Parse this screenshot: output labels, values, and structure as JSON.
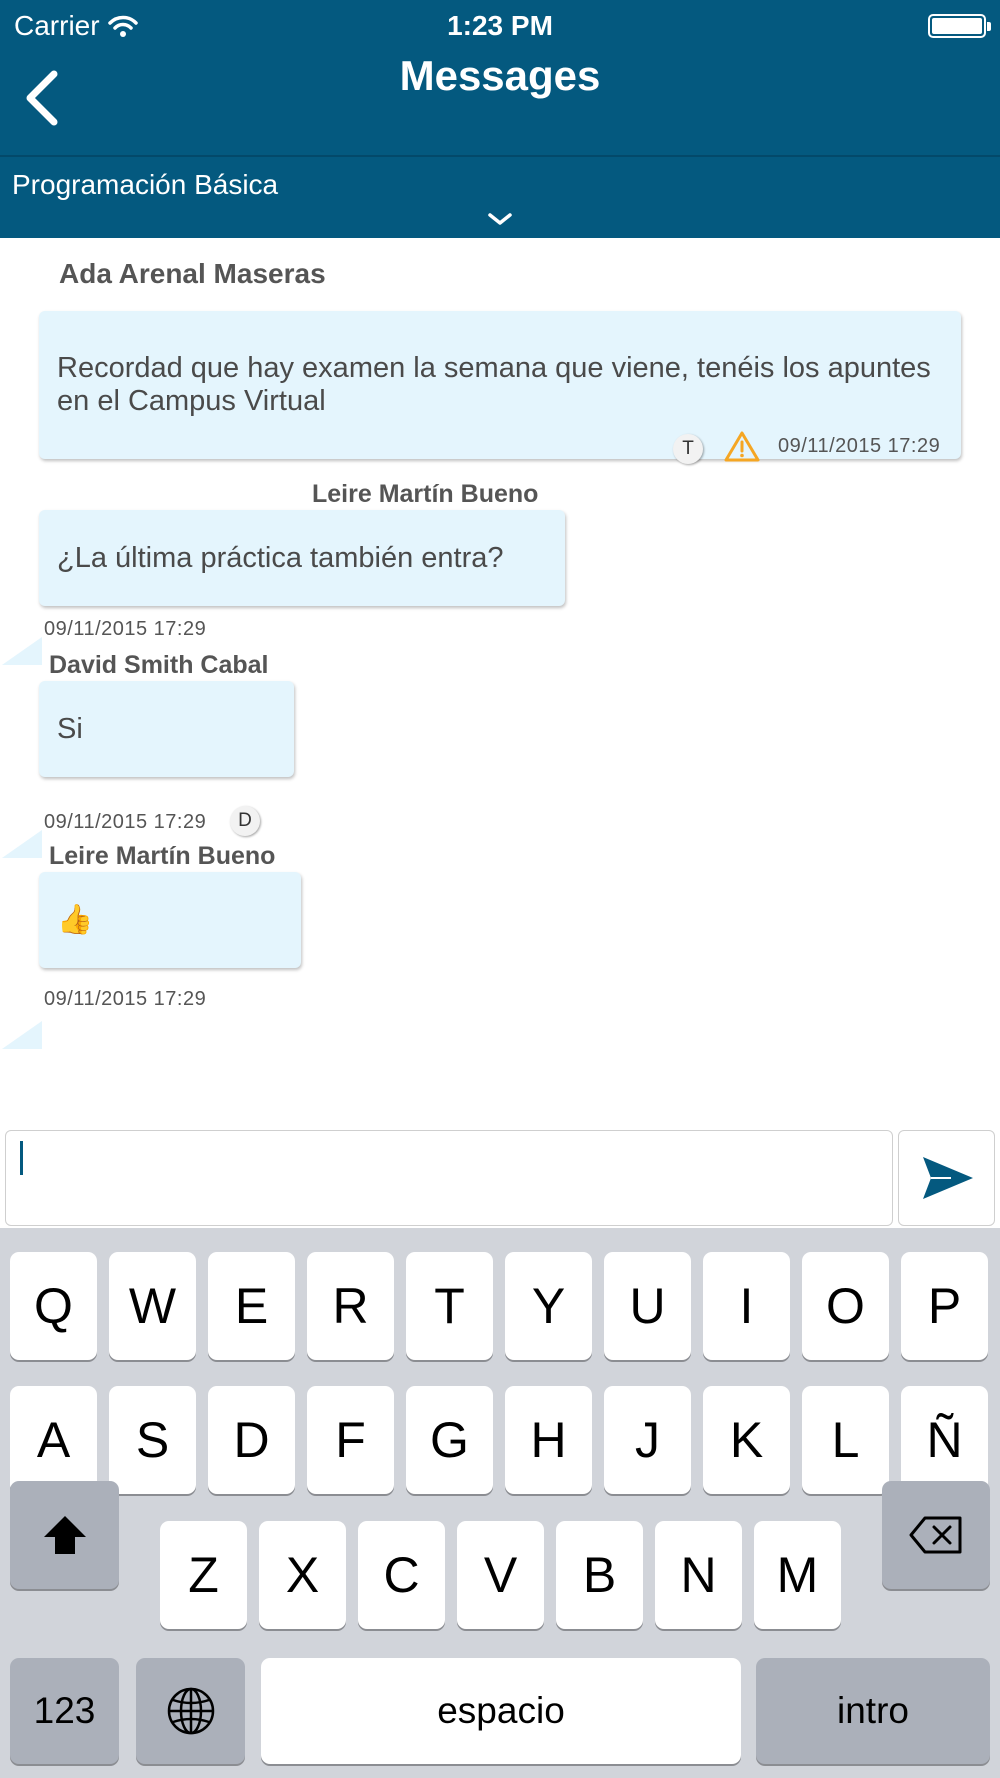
{
  "status_bar": {
    "carrier": "Carrier",
    "time": "1:23 PM"
  },
  "header": {
    "title": "Messages"
  },
  "course": {
    "name": "Programación Básica"
  },
  "messages": [
    {
      "sender": "Ada Arenal Maseras",
      "text": "Recordad que hay examen la semana que viene, tenéis los apuntes en el Campus Virtual",
      "timestamp": "09/11/2015 17:29",
      "avatar_initial": "T",
      "has_warning": true
    },
    {
      "sender": "Leire Martín Bueno",
      "text": "¿La última práctica también entra?",
      "timestamp": "09/11/2015 17:29"
    },
    {
      "sender": "David Smith Cabal",
      "text": "Si",
      "timestamp": "09/11/2015 17:29",
      "avatar_initial": "D"
    },
    {
      "sender": "Leire Martín Bueno",
      "text": "👍",
      "timestamp": "09/11/2015 17:29"
    }
  ],
  "composer": {
    "value": "",
    "send_icon": "send-icon"
  },
  "keyboard": {
    "row1": [
      "Q",
      "W",
      "E",
      "R",
      "T",
      "Y",
      "U",
      "I",
      "O",
      "P"
    ],
    "row2": [
      "A",
      "S",
      "D",
      "F",
      "G",
      "H",
      "J",
      "K",
      "L",
      "Ñ"
    ],
    "row3": [
      "Z",
      "X",
      "C",
      "V",
      "B",
      "N",
      "M"
    ],
    "numbers_label": "123",
    "space_label": "espacio",
    "return_label": "intro"
  },
  "colors": {
    "brand": "#04597f",
    "bubble": "#e4f5fd",
    "keyboard_bg": "#d1d4da",
    "warning": "#f5a623"
  }
}
